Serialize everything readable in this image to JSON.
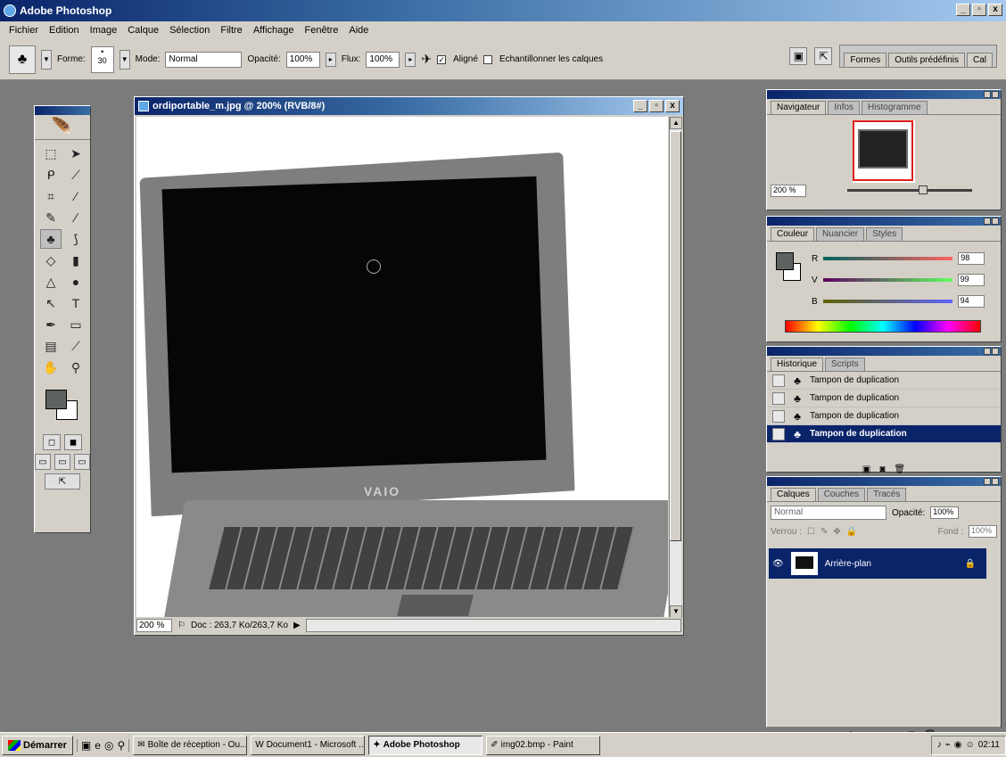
{
  "app": {
    "title": "Adobe Photoshop",
    "window_buttons": [
      "_",
      "▫",
      "x"
    ]
  },
  "menu": [
    "Fichier",
    "Edition",
    "Image",
    "Calque",
    "Sélection",
    "Filtre",
    "Affichage",
    "Fenêtre",
    "Aide"
  ],
  "options": {
    "forme_label": "Forme:",
    "brush_size": "30",
    "mode_label": "Mode:",
    "mode_value": "Normal",
    "opacity_label": "Opacité:",
    "opacity_value": "100%",
    "flux_label": "Flux:",
    "flux_value": "100%",
    "aligne_label": "Aligné",
    "aligne_checked": true,
    "echantillonner_label": "Echantillonner les calques",
    "echantillonner_checked": false,
    "well_tabs": [
      "Formes",
      "Outils prédéfinis",
      "Cal"
    ]
  },
  "document": {
    "title": "ordiportable_m.jpg @ 200% (RVB/8#)",
    "zoom": "200 %",
    "doc_size": "Doc : 263,7 Ko/263,7 Ko",
    "logo_text": "VAIO"
  },
  "navigator": {
    "tabs": [
      "Navigateur",
      "Infos",
      "Histogramme"
    ],
    "zoom": "200 %"
  },
  "color": {
    "tabs": [
      "Couleur",
      "Nuancier",
      "Styles"
    ],
    "sliders": [
      {
        "label": "R",
        "value": "98"
      },
      {
        "label": "V",
        "value": "99"
      },
      {
        "label": "B",
        "value": "94"
      }
    ]
  },
  "history": {
    "tabs": [
      "Historique",
      "Scripts"
    ],
    "items": [
      {
        "label": "Tampon de duplication",
        "selected": false
      },
      {
        "label": "Tampon de duplication",
        "selected": false
      },
      {
        "label": "Tampon de duplication",
        "selected": false
      },
      {
        "label": "Tampon de duplication",
        "selected": true
      }
    ]
  },
  "layers": {
    "tabs": [
      "Calques",
      "Couches",
      "Tracés"
    ],
    "mode": "Normal",
    "opacity_label": "Opacité:",
    "opacity_value": "100%",
    "lock_label": "Verrou :",
    "fill_label": "Fond :",
    "fill_value": "100%",
    "layer_name": "Arrière-plan"
  },
  "taskbar": {
    "start": "Démarrer",
    "tasks": [
      {
        "label": "Boîte de réception - Ou...",
        "active": false
      },
      {
        "label": "Document1 - Microsoft ...",
        "active": false
      },
      {
        "label": "Adobe Photoshop",
        "active": true
      },
      {
        "label": "img02.bmp - Paint",
        "active": false
      }
    ],
    "clock": "02:11"
  }
}
